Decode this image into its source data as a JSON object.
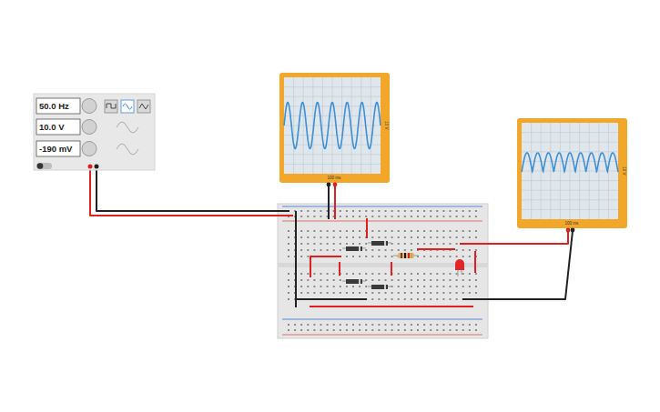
{
  "function_generator": {
    "frequency": "50.0 Hz",
    "amplitude": "10.0 V",
    "offset": "-190 mV",
    "power_on": false,
    "waveforms": [
      {
        "kind": "square",
        "selected": false
      },
      {
        "kind": "sine",
        "selected": true
      },
      {
        "kind": "triangle",
        "selected": false
      }
    ]
  },
  "oscilloscopes": [
    {
      "name": "input-scope",
      "time_label": "100 ms",
      "volt_label": "10 V",
      "waveform": "sine",
      "cycles": 6.5,
      "level": 0.48
    },
    {
      "name": "output-scope",
      "time_label": "100 ms",
      "volt_label": "10 V",
      "waveform": "rectified",
      "cycles": 9,
      "level": 0.2
    }
  ]
}
